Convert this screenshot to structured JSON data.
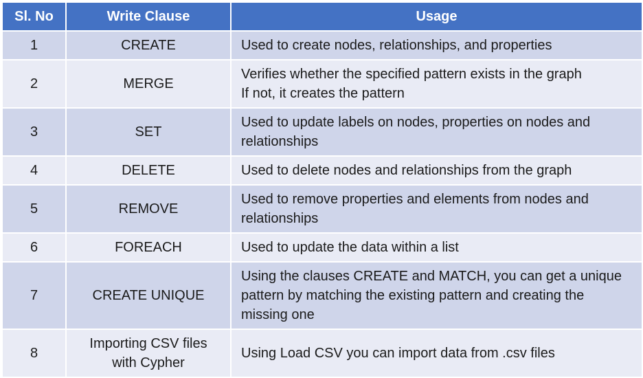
{
  "table": {
    "headers": [
      "Sl. No",
      "Write Clause",
      "Usage"
    ],
    "rows": [
      {
        "num": "1",
        "clause": [
          "CREATE"
        ],
        "usage": [
          "Used to create nodes, relationships, and properties"
        ]
      },
      {
        "num": "2",
        "clause": [
          "MERGE"
        ],
        "usage": [
          "Verifies whether the specified pattern exists in the graph",
          "If not, it creates the pattern"
        ]
      },
      {
        "num": "3",
        "clause": [
          "SET"
        ],
        "usage": [
          "Used to update labels on nodes, properties on nodes and",
          "relationships"
        ]
      },
      {
        "num": "4",
        "clause": [
          "DELETE"
        ],
        "usage": [
          "Used to delete nodes and relationships from the graph"
        ]
      },
      {
        "num": "5",
        "clause": [
          "REMOVE"
        ],
        "usage": [
          "Used to remove properties and elements from nodes and",
          "relationships"
        ]
      },
      {
        "num": "6",
        "clause": [
          "FOREACH"
        ],
        "usage": [
          "Used to update the data within a list"
        ]
      },
      {
        "num": "7",
        "clause": [
          "CREATE UNIQUE"
        ],
        "usage": [
          "Using the clauses CREATE and MATCH, you can get a unique",
          "pattern by matching the existing pattern and creating the",
          "missing one"
        ]
      },
      {
        "num": "8",
        "clause": [
          "Importing CSV files",
          "with Cypher"
        ],
        "usage": [
          "Using Load CSV you can import data from .csv files"
        ]
      }
    ]
  }
}
